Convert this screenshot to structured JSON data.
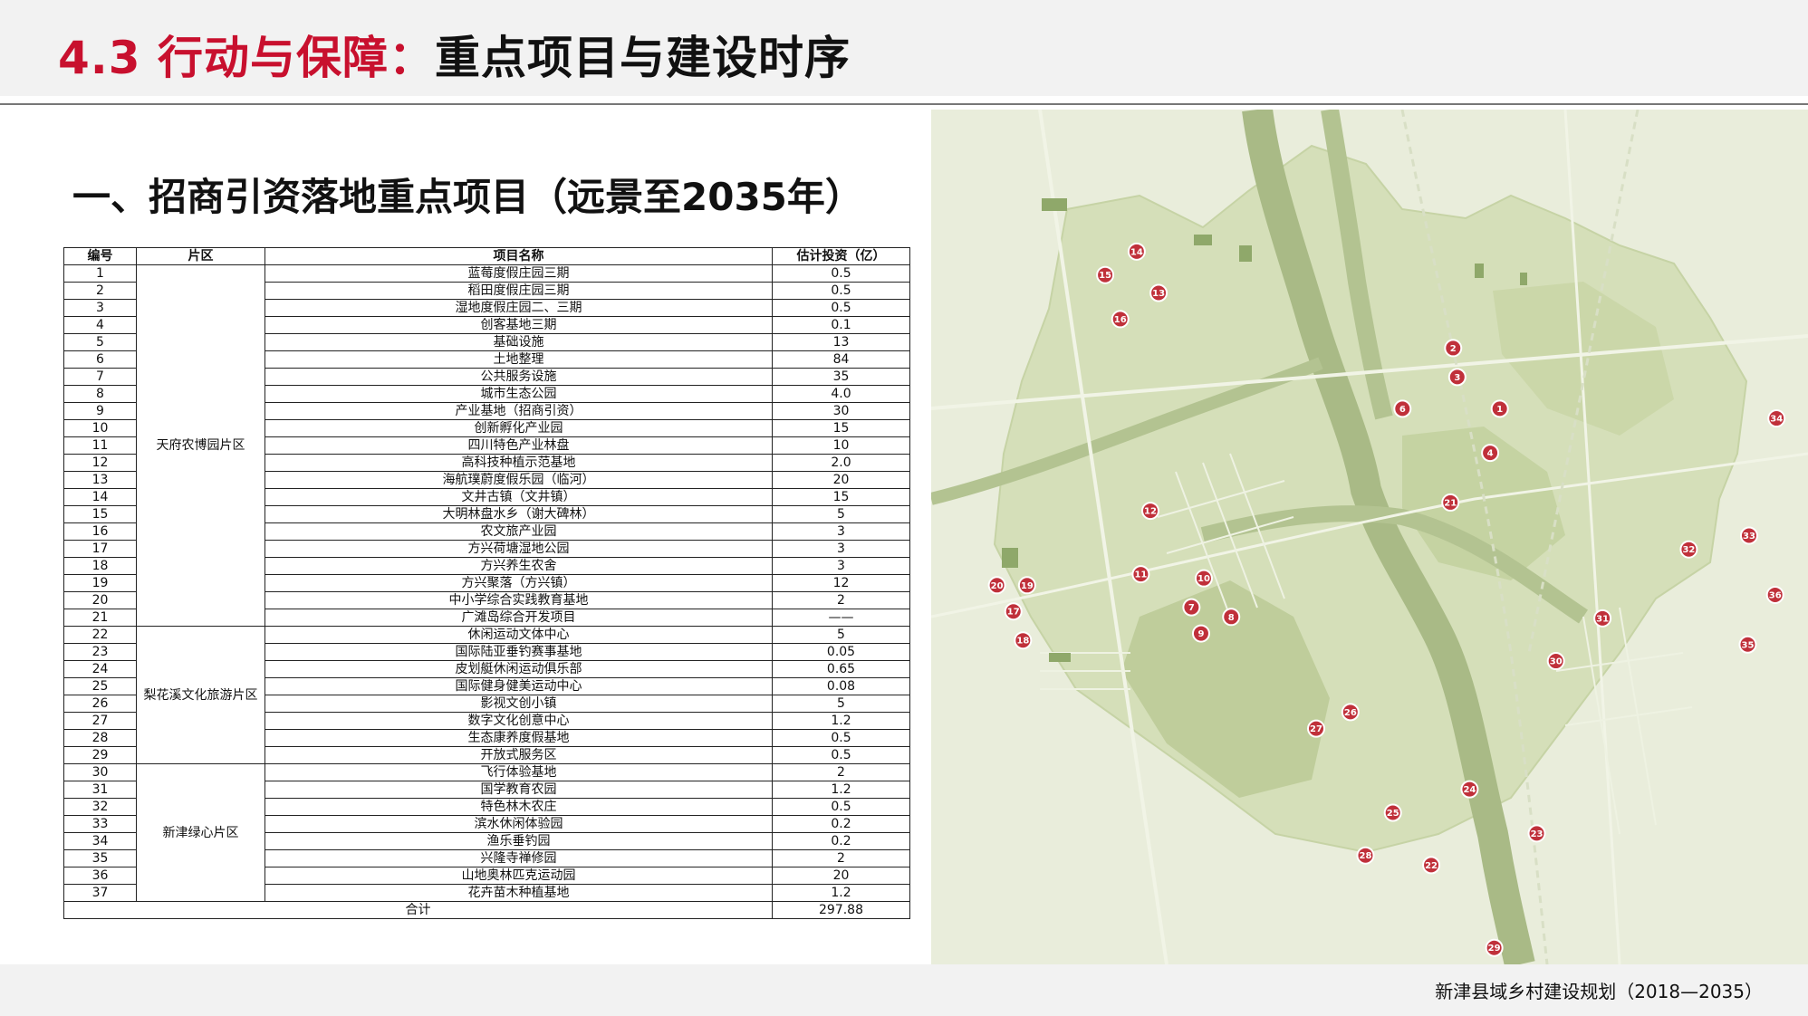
{
  "header": {
    "title_number": "4.3",
    "title_red": "行动与保障：",
    "title_black": "重点项目与建设时序"
  },
  "section_heading": "一、招商引资落地重点项目（远景至2035年）",
  "table": {
    "headers": [
      "编号",
      "片区",
      "项目名称",
      "估计投资（亿）"
    ],
    "areas": [
      {
        "name": "天府农博园片区",
        "rows": [
          [
            "1",
            "蓝莓度假庄园三期",
            "0.5"
          ],
          [
            "2",
            "稻田度假庄园三期",
            "0.5"
          ],
          [
            "3",
            "湿地度假庄园二、三期",
            "0.5"
          ],
          [
            "4",
            "创客基地三期",
            "0.1"
          ],
          [
            "5",
            "基础设施",
            "13"
          ],
          [
            "6",
            "土地整理",
            "84"
          ],
          [
            "7",
            "公共服务设施",
            "35"
          ],
          [
            "8",
            "城市生态公园",
            "4.0"
          ],
          [
            "9",
            "产业基地（招商引资）",
            "30"
          ],
          [
            "10",
            "创新孵化产业园",
            "15"
          ],
          [
            "11",
            "四川特色产业林盘",
            "10"
          ],
          [
            "12",
            "高科技种植示范基地",
            "2.0"
          ],
          [
            "13",
            "海航璞蔚度假乐园（临河）",
            "20"
          ],
          [
            "14",
            "文井古镇（文井镇）",
            "15"
          ],
          [
            "15",
            "大明林盘水乡（谢大碑林）",
            "5"
          ],
          [
            "16",
            "农文旅产业园",
            "3"
          ],
          [
            "17",
            "方兴荷塘湿地公园",
            "3"
          ],
          [
            "18",
            "方兴养生农舍",
            "3"
          ],
          [
            "19",
            "方兴聚落（方兴镇）",
            "12"
          ],
          [
            "20",
            "中小学综合实践教育基地",
            "2"
          ],
          [
            "21",
            "广滩岛综合开发项目",
            "——"
          ]
        ]
      },
      {
        "name": "梨花溪文化旅游片区",
        "rows": [
          [
            "22",
            "休闲运动文体中心",
            "5"
          ],
          [
            "23",
            "国际陆亚垂钓赛事基地",
            "0.05"
          ],
          [
            "24",
            "皮划艇休闲运动俱乐部",
            "0.65"
          ],
          [
            "25",
            "国际健身健美运动中心",
            "0.08"
          ],
          [
            "26",
            "影视文创小镇",
            "5"
          ],
          [
            "27",
            "数字文化创意中心",
            "1.2"
          ],
          [
            "28",
            "生态康养度假基地",
            "0.5"
          ],
          [
            "29",
            "开放式服务区",
            "0.5"
          ]
        ]
      },
      {
        "name": "新津绿心片区",
        "rows": [
          [
            "30",
            "飞行体验基地",
            "2"
          ],
          [
            "31",
            "国学教育农园",
            "1.2"
          ],
          [
            "32",
            "特色林木农庄",
            "0.5"
          ],
          [
            "33",
            "滨水休闲体验园",
            "0.2"
          ],
          [
            "34",
            "渔乐垂钓园",
            "0.2"
          ],
          [
            "35",
            "兴隆寺禅修园",
            "2"
          ],
          [
            "36",
            "山地奥林匹克运动园",
            "20"
          ],
          [
            "37",
            "花卉苗木种植基地",
            "1.2"
          ]
        ]
      }
    ],
    "total_label": "合计",
    "total_value": "297.88"
  },
  "map": {
    "colors": {
      "base": "#e7ecd6",
      "land": "#d3deb6",
      "dark": "#b9c995",
      "river": "#a8b987",
      "road": "#f4f6ec",
      "marker": "#c0303a"
    },
    "markers": [
      "1",
      "2",
      "3",
      "4",
      "6",
      "7",
      "8",
      "9",
      "10",
      "11",
      "12",
      "13",
      "14",
      "15",
      "16",
      "17",
      "18",
      "19",
      "20",
      "21",
      "22",
      "23",
      "24",
      "25",
      "26",
      "27",
      "28",
      "29",
      "30",
      "31",
      "32",
      "33",
      "34",
      "35",
      "36"
    ]
  },
  "footer": {
    "text": "新津县域乡村建设规划（2018—2035）"
  }
}
